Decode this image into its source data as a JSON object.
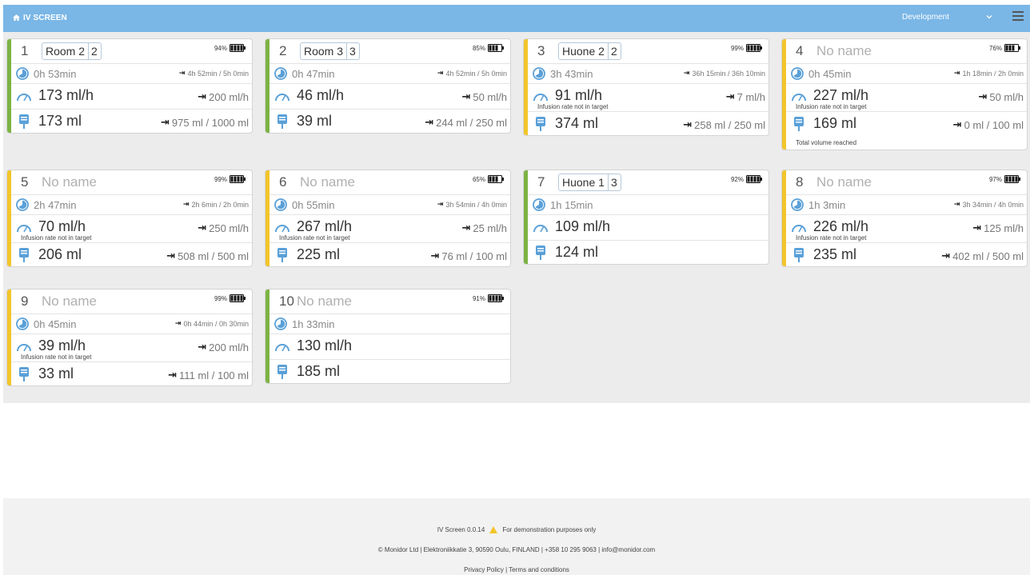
{
  "header": {
    "title": "IV SCREEN",
    "environment": "Development",
    "menu_icon": "hamburger-icon",
    "home_icon": "home-icon"
  },
  "colors": {
    "ok": "#7cb342",
    "warning": "#f2c52a",
    "header": "#7ab6e6"
  },
  "cards": [
    {
      "id": "1",
      "name": "Room 2",
      "bed": "2",
      "named": true,
      "status": "green",
      "battery": "94%",
      "time": "0h 53min",
      "time_target": "4h 52min / 5h 0min",
      "rate": "173 ml/h",
      "rate_target": "200 ml/h",
      "rate_note": "",
      "volume": "173 ml",
      "volume_target": "975 ml / 1000 ml",
      "volume_note": ""
    },
    {
      "id": "2",
      "name": "Room 3",
      "bed": "3",
      "named": true,
      "status": "green",
      "battery": "85%",
      "time": "0h 47min",
      "time_target": "4h 52min / 5h 0min",
      "rate": "46 ml/h",
      "rate_target": "50 ml/h",
      "rate_note": "",
      "volume": "39 ml",
      "volume_target": "244 ml / 250 ml",
      "volume_note": ""
    },
    {
      "id": "3",
      "name": "Huone 2",
      "bed": "2",
      "named": true,
      "status": "yellow",
      "battery": "99%",
      "time": "3h 43min",
      "time_target": "36h 15min / 36h 10min",
      "rate": "91 ml/h",
      "rate_target": "7 ml/h",
      "rate_note": "Infusion rate not in target",
      "volume": "374 ml",
      "volume_target": "258 ml / 250 ml",
      "volume_note": ""
    },
    {
      "id": "4",
      "name": "No name",
      "bed": "",
      "named": false,
      "status": "yellow",
      "battery": "76%",
      "time": "0h 45min",
      "time_target": "1h 18min / 2h 0min",
      "rate": "227 ml/h",
      "rate_target": "50 ml/h",
      "rate_note": "Infusion rate not in target",
      "volume": "169 ml",
      "volume_target": "0 ml / 100 ml",
      "volume_note": "Total volume reached"
    },
    {
      "id": "5",
      "name": "No name",
      "bed": "",
      "named": false,
      "status": "yellow",
      "battery": "99%",
      "time": "2h 47min",
      "time_target": "2h 6min / 2h 0min",
      "rate": "70 ml/h",
      "rate_target": "250 ml/h",
      "rate_note": "Infusion rate not in target",
      "volume": "206 ml",
      "volume_target": "508 ml / 500 ml",
      "volume_note": ""
    },
    {
      "id": "6",
      "name": "No name",
      "bed": "",
      "named": false,
      "status": "yellow",
      "battery": "65%",
      "time": "0h 55min",
      "time_target": "3h 54min / 4h 0min",
      "rate": "267 ml/h",
      "rate_target": "25 ml/h",
      "rate_note": "Infusion rate not in target",
      "volume": "225 ml",
      "volume_target": "76 ml / 100 ml",
      "volume_note": ""
    },
    {
      "id": "7",
      "name": "Huone 1",
      "bed": "3",
      "named": true,
      "status": "green",
      "battery": "92%",
      "time": "1h 15min",
      "time_target": "",
      "rate": "109 ml/h",
      "rate_target": "",
      "rate_note": "",
      "volume": "124 ml",
      "volume_target": "",
      "volume_note": ""
    },
    {
      "id": "8",
      "name": "No name",
      "bed": "",
      "named": false,
      "status": "yellow",
      "battery": "97%",
      "time": "1h 3min",
      "time_target": "3h 34min / 4h 0min",
      "rate": "226 ml/h",
      "rate_target": "125 ml/h",
      "rate_note": "Infusion rate not in target",
      "volume": "235 ml",
      "volume_target": "402 ml / 500 ml",
      "volume_note": ""
    },
    {
      "id": "9",
      "name": "No name",
      "bed": "",
      "named": false,
      "status": "yellow",
      "battery": "99%",
      "time": "0h 45min",
      "time_target": "0h 44min / 0h 30min",
      "rate": "39 ml/h",
      "rate_target": "200 ml/h",
      "rate_note": "Infusion rate not in target",
      "volume": "33 ml",
      "volume_target": "111 ml / 100 ml",
      "volume_note": ""
    },
    {
      "id": "10",
      "name": "No name",
      "bed": "",
      "named": false,
      "status": "green",
      "battery": "91%",
      "time": "1h 33min",
      "time_target": "",
      "rate": "130 ml/h",
      "rate_target": "",
      "rate_note": "",
      "volume": "185 ml",
      "volume_target": "",
      "volume_note": ""
    }
  ],
  "footer": {
    "version": "IV Screen 0.0.14",
    "warning_icon": "warning-icon",
    "demo_text": "For demonstration purposes only",
    "company": "© Monidor Ltd | Elektroniikkatie 3, 90590 Oulu, FINLAND | +358 10 295 9063 | info@monidor.com",
    "privacy": "Privacy Policy",
    "separator": "|",
    "terms": "Terms and conditions"
  }
}
